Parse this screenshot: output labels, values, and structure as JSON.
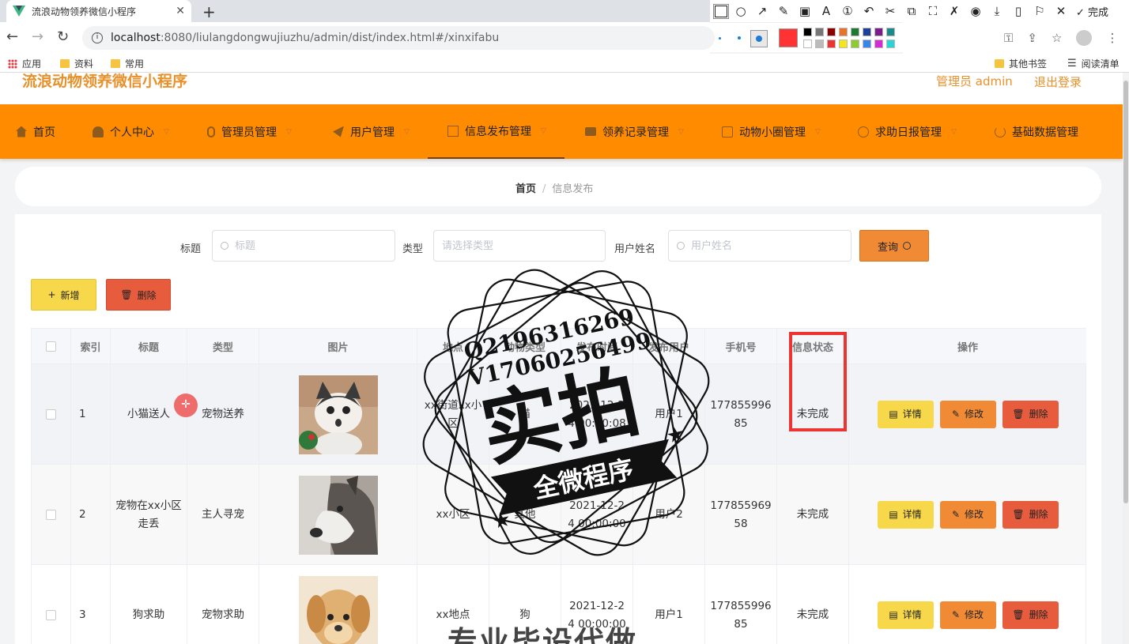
{
  "browser": {
    "tab_title": "流浪动物领养微信小程序",
    "url_host": "localhost",
    "url_path": ":8080/liulangdongwujiuzhu/admin/dist/index.html#/xinxifabu",
    "bookmarks": [
      "应用",
      "资料",
      "常用"
    ],
    "bookmarks_right": [
      "其他书签",
      "阅读清单"
    ],
    "annot_done": "完成"
  },
  "header": {
    "site_title": "流浪动物领养微信小程序",
    "admin_label": "管理员 admin",
    "logout_label": "退出登录"
  },
  "menu": [
    {
      "label": "首页"
    },
    {
      "label": "个人中心"
    },
    {
      "label": "管理员管理"
    },
    {
      "label": "用户管理"
    },
    {
      "label": "信息发布管理"
    },
    {
      "label": "领养记录管理"
    },
    {
      "label": "动物小圈管理"
    },
    {
      "label": "求助日报管理"
    },
    {
      "label": "基础数据管理"
    }
  ],
  "breadcrumb": {
    "home": "首页",
    "current": "信息发布"
  },
  "search": {
    "title_label": "标题",
    "title_placeholder": "标题",
    "type_label": "类型",
    "type_placeholder": "请选择类型",
    "user_label": "用户姓名",
    "user_placeholder": "用户姓名",
    "query_label": "查询"
  },
  "actions": {
    "add_label": "新增",
    "delete_label": "删除"
  },
  "table": {
    "headers": {
      "index": "索引",
      "title": "标题",
      "type": "类型",
      "image": "图片",
      "place": "地点",
      "animal_type": "动物类型",
      "time": "发布时间",
      "user": "发布用户",
      "phone": "手机号",
      "status": "信息状态",
      "ops": "操作"
    },
    "rows": [
      {
        "index": "1",
        "title": "小猫送人",
        "type": "宠物送养",
        "place": "xx街道xx小区",
        "animal_type": "猫",
        "time": "2021-12-24 00:00:08",
        "user": "用户1",
        "phone": "17785599685",
        "status": "未完成",
        "image": "cat"
      },
      {
        "index": "2",
        "title": "宠物在xx小区走丢",
        "type": "主人寻宠",
        "place": "xx小区",
        "animal_type": "其他",
        "time": "2021-12-24 00:00:00",
        "user": "用户2",
        "phone": "17785596958",
        "status": "未完成",
        "image": "husky"
      },
      {
        "index": "3",
        "title": "狗求助",
        "type": "宠物求助",
        "place": "xx地点",
        "animal_type": "狗",
        "time": "2021-12-24 00:00:00",
        "user": "用户1",
        "phone": "17785599685",
        "status": "未完成",
        "image": "puppy"
      }
    ],
    "row_buttons": {
      "detail": "详情",
      "edit": "修改",
      "delete": "删除"
    }
  },
  "watermark": {
    "line1": "Q2196316269",
    "line2": "V17060256499",
    "big": "实拍",
    "banner": "全微程序",
    "bottom": "专业毕设代做"
  },
  "colors": {
    "accent": "#ff8c00",
    "yellow_btn": "#f7d84a",
    "orange_btn": "#f08a35",
    "red_btn": "#e85c3e"
  }
}
